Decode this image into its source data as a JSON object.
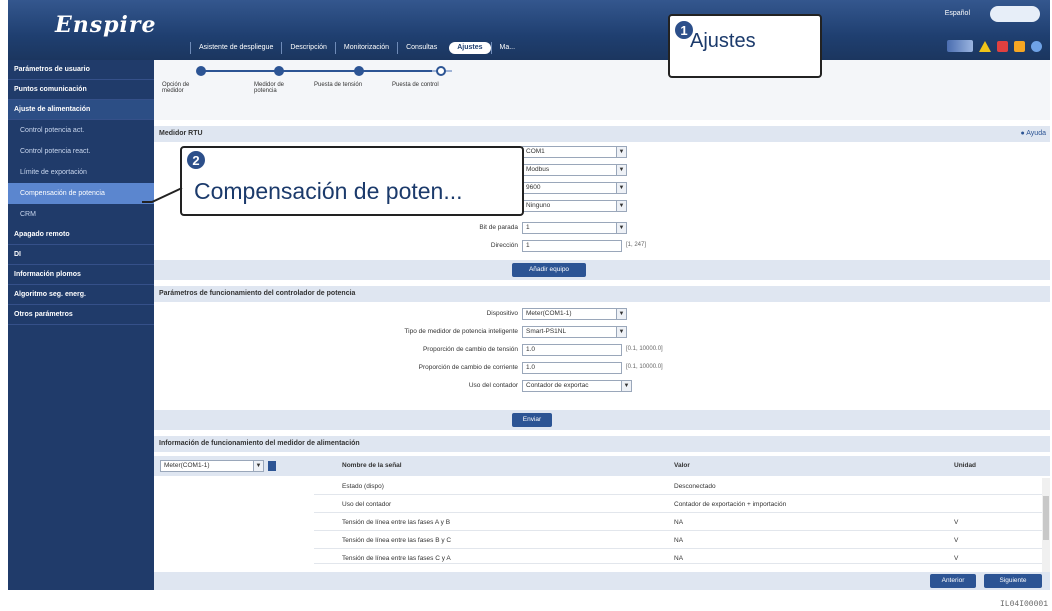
{
  "header": {
    "logo": "Enspire",
    "logo_small": "",
    "language_label": "Español",
    "language_value": "",
    "tabs": [
      "Asistente de despliegue",
      "Descripción",
      "Monitorización",
      "Consultas",
      "Ajustes",
      "Ma..."
    ]
  },
  "sidebar": {
    "items": [
      {
        "label": "Parámetros de usuario",
        "type": "top"
      },
      {
        "label": "Puntos comunicación",
        "type": "top"
      },
      {
        "label": "Ajuste de alimentación",
        "type": "group"
      },
      {
        "label": "Control potencia act.",
        "type": "sub"
      },
      {
        "label": "Control potencia react.",
        "type": "sub"
      },
      {
        "label": "Límite de exportación",
        "type": "sub"
      },
      {
        "label": "Compensación de potencia",
        "type": "sub-active"
      },
      {
        "label": "CRM",
        "type": "sub"
      },
      {
        "label": "Apagado remoto",
        "type": "top"
      },
      {
        "label": "DI",
        "type": "top"
      },
      {
        "label": "Información plomos",
        "type": "top"
      },
      {
        "label": "Algoritmo seg. energ.",
        "type": "top"
      },
      {
        "label": "Otros parámetros",
        "type": "top"
      }
    ]
  },
  "stepper": {
    "steps": [
      "Opción de medidor",
      "Medidor de potencia",
      "Puesta de tensión",
      "Puesta de control"
    ]
  },
  "section1": {
    "title": "Medidor RTU",
    "help": "Ayuda",
    "fields": [
      {
        "label": "",
        "value": "COM1",
        "kind": "select"
      },
      {
        "label": "",
        "value": "Modbus",
        "kind": "select"
      },
      {
        "label": "",
        "value": "9600",
        "kind": "select"
      },
      {
        "label": "",
        "value": "Ninguno",
        "kind": "select"
      },
      {
        "label": "Bit de parada",
        "value": "1",
        "kind": "select"
      },
      {
        "label": "Dirección",
        "value": "1",
        "kind": "input",
        "hint": "[1, 247]"
      }
    ],
    "button": "Añadir equipo"
  },
  "section2": {
    "title": "Parámetros de funcionamiento del controlador de potencia",
    "fields": [
      {
        "label": "Dispositivo",
        "value": "Meter(COM1-1)",
        "kind": "select"
      },
      {
        "label": "Tipo de medidor de potencia inteligente",
        "value": "Smart-PS1NL",
        "kind": "select"
      },
      {
        "label": "Proporción de cambio de tensión",
        "value": "1.0",
        "kind": "input",
        "hint": "[0.1, 10000.0]"
      },
      {
        "label": "Proporción de cambio de corriente",
        "value": "1.0",
        "kind": "input",
        "hint": "[0.1, 10000.0]"
      },
      {
        "label": "Uso del contador",
        "value": "Contador de exportac",
        "kind": "select"
      }
    ],
    "button": "Enviar"
  },
  "section3": {
    "title": "Información de funcionamiento del medidor de alimentación",
    "device_select": "Meter(COM1-1)",
    "columns": [
      "Nombre de la señal",
      "Valor",
      "Unidad"
    ],
    "rows": [
      [
        "Estado (dispo)",
        "Desconectado",
        ""
      ],
      [
        "Uso del contador",
        "Contador de exportación + importación",
        ""
      ],
      [
        "Tensión de línea entre las fases A y B",
        "NA",
        "V"
      ],
      [
        "Tensión de línea entre las fases B y C",
        "NA",
        "V"
      ],
      [
        "Tensión de línea entre las fases C y A",
        "NA",
        "V"
      ]
    ]
  },
  "footer": {
    "prev": "Anterior",
    "next": "Siguiente"
  },
  "callouts": {
    "c1_num": "1",
    "c1_text": "Ajustes",
    "c2_num": "2",
    "c2_text": "Compensación de poten..."
  },
  "figure_id": "IL04I00001"
}
